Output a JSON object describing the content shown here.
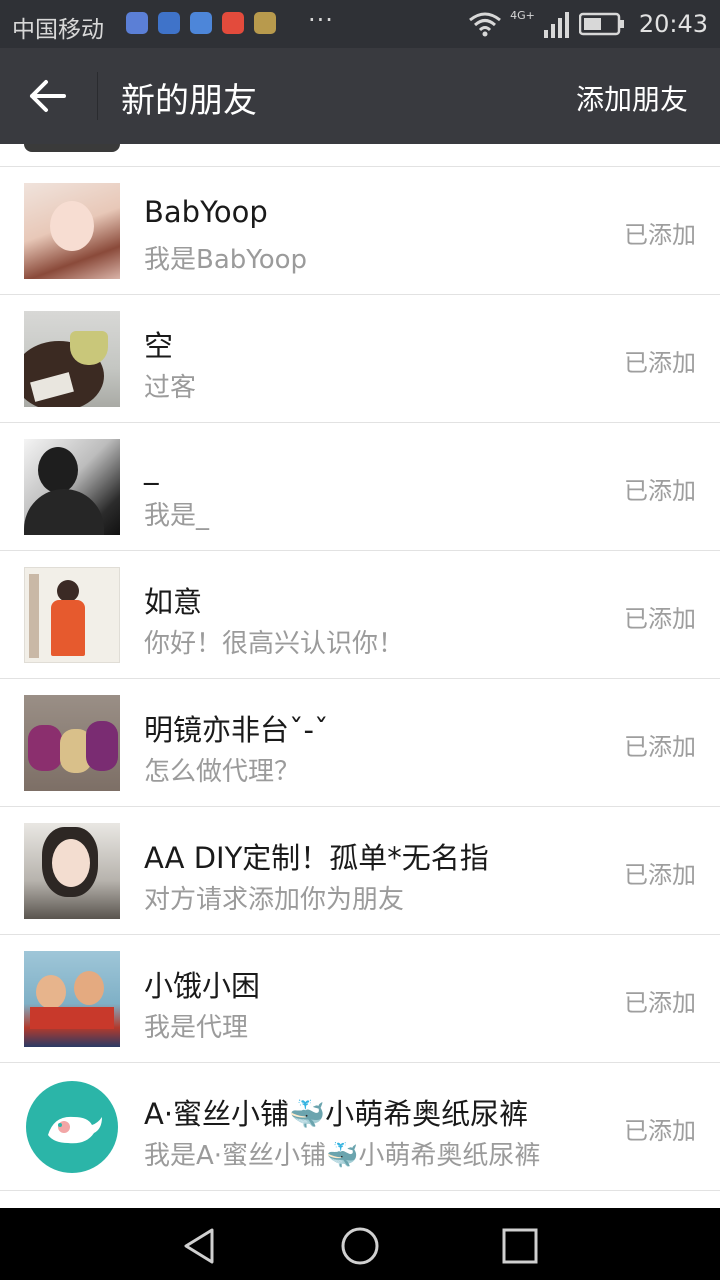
{
  "status_bar": {
    "carrier": "中国移动",
    "more": "···",
    "network": "4G+",
    "time": "20:43"
  },
  "title_bar": {
    "title": "新的朋友",
    "action": "添加朋友"
  },
  "requests": [
    {
      "name": "BabYoop",
      "message": "我是BabYoop",
      "status": "已添加"
    },
    {
      "name": "空",
      "message": "过客",
      "status": "已添加"
    },
    {
      "name": "_",
      "message": "我是_",
      "status": "已添加"
    },
    {
      "name": "如意",
      "message": "你好！很高兴认识你！",
      "status": "已添加"
    },
    {
      "name": "明镜亦非台ˇ-ˇ",
      "message": "怎么做代理？",
      "status": "已添加"
    },
    {
      "name": "AA DIY定制！孤单*无名指",
      "message": "对方请求添加你为朋友",
      "status": "已添加"
    },
    {
      "name": "小饿小困",
      "message": "我是代理",
      "status": "已添加"
    },
    {
      "name": "A·蜜丝小铺🐳小萌希奥纸尿裤",
      "message": "我是A·蜜丝小铺🐳小萌希奥纸尿裤",
      "status": "已添加"
    }
  ],
  "colors": {
    "status_bar_bg": "#2f3136",
    "title_bar_bg": "#393a3f",
    "divider": "#e2e2e2",
    "secondary_text": "#9b9b9b"
  }
}
